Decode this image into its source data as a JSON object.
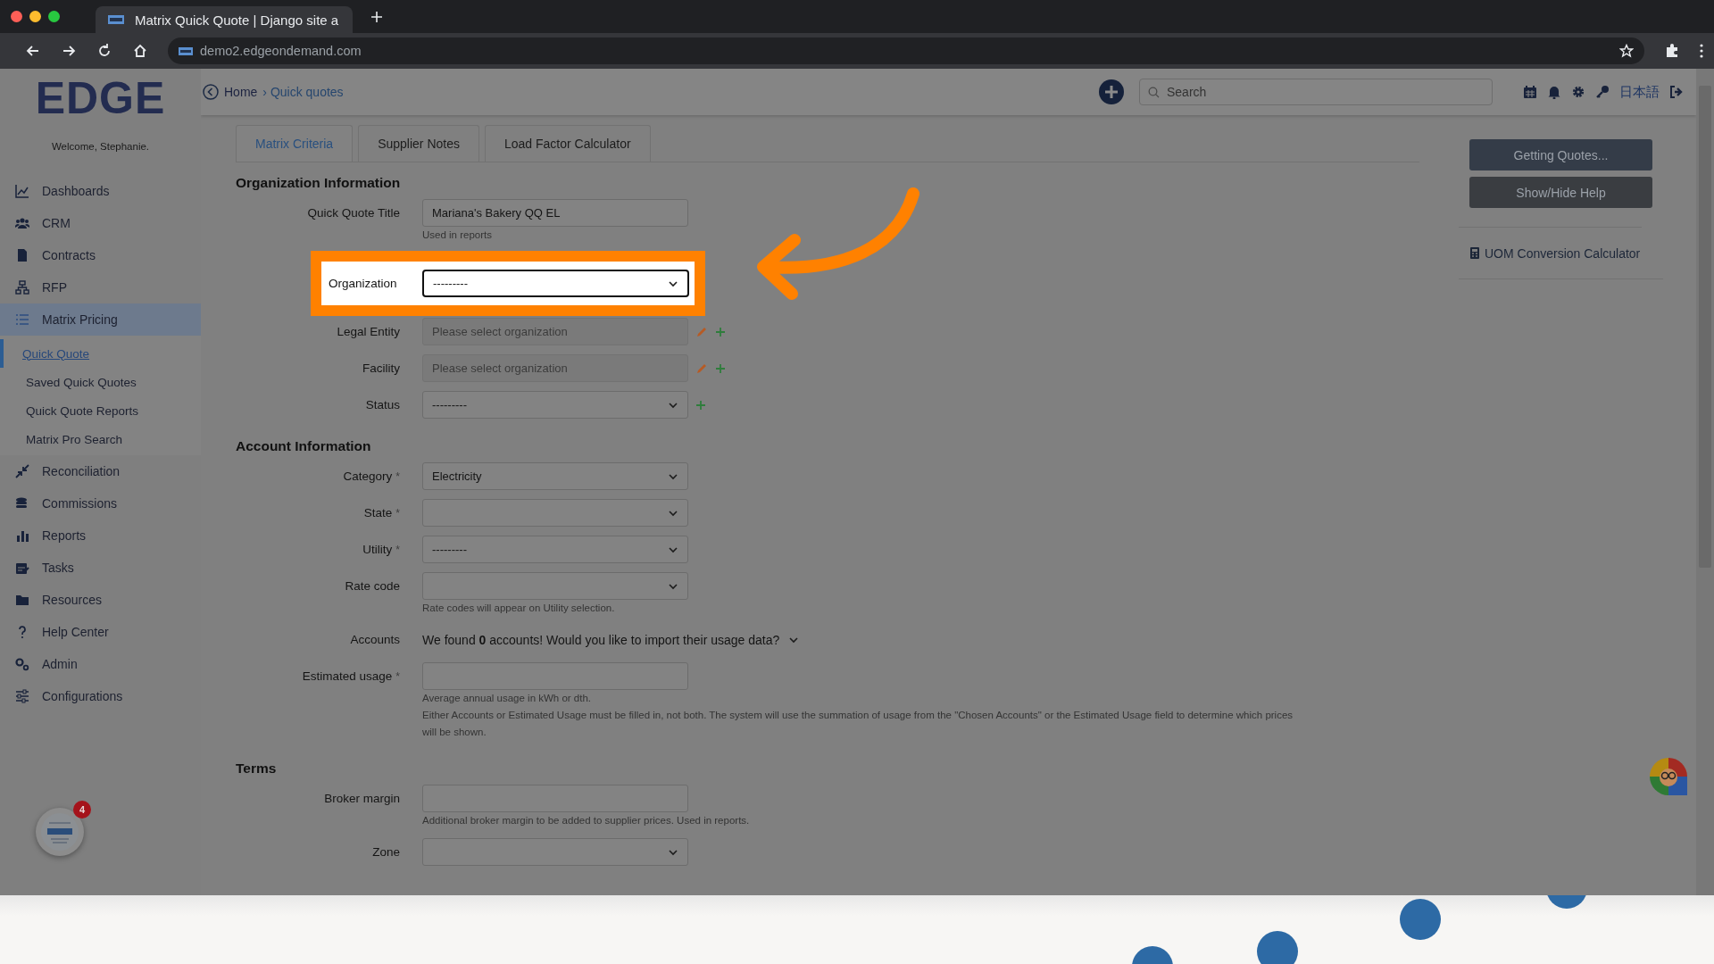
{
  "browser": {
    "tab_title": "Matrix Quick Quote | Django site a",
    "url": "demo2.edgeondemand.com"
  },
  "header": {
    "breadcrumb": [
      {
        "label": "Home"
      },
      {
        "label": "› Quick quotes"
      }
    ],
    "search": {
      "placeholder": "Search"
    },
    "language": "日本語"
  },
  "sidebar": {
    "logo": "EDGE",
    "welcome": "Welcome, Stephanie.",
    "items": [
      {
        "label": "Dashboards",
        "selected": false
      },
      {
        "label": "CRM",
        "selected": false
      },
      {
        "label": "Contracts",
        "selected": false
      },
      {
        "label": "RFP",
        "selected": false
      },
      {
        "label": "Matrix Pricing",
        "selected": true,
        "expanded": true,
        "children": [
          {
            "label": "Quick Quote",
            "selected": true
          },
          {
            "label": "Saved Quick Quotes",
            "selected": false
          },
          {
            "label": "Quick Quote Reports",
            "selected": false
          },
          {
            "label": "Matrix Pro Search",
            "selected": false
          }
        ]
      },
      {
        "label": "Reconciliation",
        "selected": false
      },
      {
        "label": "Commissions",
        "selected": false
      },
      {
        "label": "Reports",
        "selected": false
      },
      {
        "label": "Tasks",
        "selected": false
      },
      {
        "label": "Resources",
        "selected": false
      },
      {
        "label": "Help Center",
        "selected": false
      },
      {
        "label": "Admin",
        "selected": false
      },
      {
        "label": "Configurations",
        "selected": false
      }
    ],
    "notification_count": "4"
  },
  "tabs": [
    {
      "label": "Matrix Criteria",
      "selected": true
    },
    {
      "label": "Supplier Notes",
      "selected": false
    },
    {
      "label": "Load Factor Calculator",
      "selected": false
    }
  ],
  "sections": [
    {
      "title": "Organization Information",
      "fields": [
        {
          "label": "Quick Quote Title",
          "kind": "text",
          "value": "Mariana's Bakery QQ EL",
          "hints": [
            "Used in reports"
          ]
        },
        {
          "label": "Organization",
          "kind": "select",
          "value": "---------",
          "highlighted": true
        },
        {
          "label": "Legal Entity",
          "kind": "text",
          "placeholder": "Please select organization",
          "disabled": true,
          "can_edit": true,
          "can_add": true
        },
        {
          "label": "Facility",
          "kind": "text",
          "placeholder": "Please select organization",
          "disabled": true,
          "can_edit": true,
          "can_add": true
        },
        {
          "label": "Status",
          "kind": "select",
          "value": "---------",
          "can_add": true
        }
      ]
    },
    {
      "title": "Account Information",
      "fields": [
        {
          "label": "Category",
          "marker": "*",
          "kind": "select",
          "value": "Electricity"
        },
        {
          "label": "State",
          "marker": "*",
          "kind": "select"
        },
        {
          "label": "Utility",
          "marker": "*",
          "kind": "select",
          "value": "---------"
        },
        {
          "label": "Rate code",
          "kind": "select",
          "hints": [
            "Rate codes will appear on Utility selection."
          ]
        },
        {
          "label": "Accounts",
          "kind": "accounts",
          "value": "We found **0** accounts! Would you like to import their usage data?"
        },
        {
          "label": "Estimated usage",
          "marker": "*",
          "kind": "text",
          "hints": [
            "Average annual usage in kWh or dth.",
            "Either Accounts or Estimated Usage must be filled in, not both. The system will use the summation of usage from the \"Chosen Accounts\" or the Estimated Usage field to determine which prices will be shown."
          ]
        }
      ]
    },
    {
      "title": "Terms",
      "fields": [
        {
          "label": "Broker margin",
          "kind": "text",
          "hints": [
            "Additional broker margin to be added to supplier prices. Used in reports."
          ]
        },
        {
          "label": "Zone",
          "kind": "select"
        }
      ]
    }
  ],
  "side_panel": {
    "buttons": [
      {
        "label": "Getting Quotes...",
        "kind": "primary"
      },
      {
        "label": "Show/Hide Help",
        "kind": "secondary"
      }
    ],
    "links": [
      {
        "label": "UOM Conversion Calculator"
      }
    ]
  }
}
